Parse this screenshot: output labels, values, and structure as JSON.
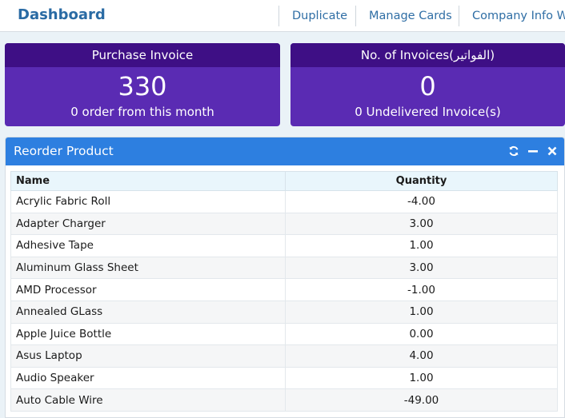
{
  "header": {
    "title": "Dashboard",
    "links": [
      "Duplicate",
      "Manage Cards",
      "Company Info Wi"
    ]
  },
  "cards": [
    {
      "title": "Purchase Invoice",
      "value": "330",
      "subtitle": "0 order from this month"
    },
    {
      "title": "No. of Invoices(الفواتير)",
      "value": "0",
      "subtitle": "0 Undelivered Invoice(s)"
    }
  ],
  "panel": {
    "title": "Reorder Product",
    "tools": [
      "refresh-icon",
      "minimize-icon",
      "close-icon"
    ],
    "columns": [
      "Name",
      "Quantity"
    ],
    "rows": [
      {
        "name": "Acrylic Fabric Roll",
        "quantity": "-4.00"
      },
      {
        "name": "Adapter Charger",
        "quantity": "3.00"
      },
      {
        "name": "Adhesive Tape",
        "quantity": "1.00"
      },
      {
        "name": "Aluminum Glass Sheet",
        "quantity": "3.00"
      },
      {
        "name": "AMD Processor",
        "quantity": "-1.00"
      },
      {
        "name": "Annealed GLass",
        "quantity": "1.00"
      },
      {
        "name": "Apple Juice Bottle",
        "quantity": "0.00"
      },
      {
        "name": "Asus Laptop",
        "quantity": "4.00"
      },
      {
        "name": "Audio Speaker",
        "quantity": "1.00"
      },
      {
        "name": "Auto Cable Wire",
        "quantity": "-49.00"
      }
    ]
  },
  "colors": {
    "brand": "#2a6ba4",
    "card_body": "#5a2bb3",
    "card_head": "#3e0f85",
    "panel_head": "#2d7fe0"
  }
}
